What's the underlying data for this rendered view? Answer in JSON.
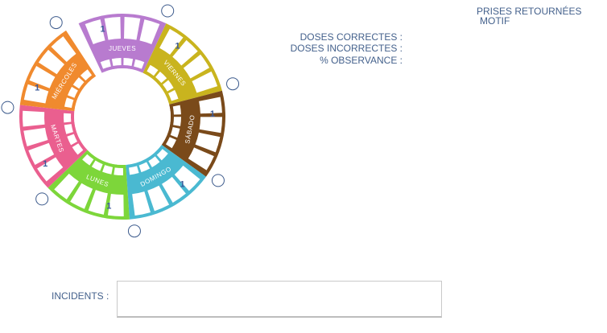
{
  "header": {
    "prises_retournees_label": "PRISES RETOURNÉES",
    "motif_label": "MOTIF"
  },
  "stats": {
    "doses_correctes_label": "DOSES CORRECTES :",
    "doses_incorrectes_label": "DOSES INCORRECTES :",
    "observance_label": "% OBSERVANCE :"
  },
  "incidents": {
    "label": "INCIDENTS :",
    "value": ""
  },
  "wheel": {
    "day_segments": [
      {
        "day": "JUEVES",
        "color": "#b87bcf",
        "count": "1"
      },
      {
        "day": "VIERNES",
        "color": "#c9b41e",
        "count": "1"
      },
      {
        "day": "SÁBADO",
        "color": "#7a4a1a",
        "count": "1"
      },
      {
        "day": "DOMINGO",
        "color": "#4ab9d1",
        "count": "1"
      },
      {
        "day": "LUNES",
        "color": "#7dd63a",
        "count": "1"
      },
      {
        "day": "MARTES",
        "color": "#ea5f8f",
        "count": "1"
      },
      {
        "day": "MIÉRCOLES",
        "color": "#f08a2e",
        "count": "1"
      }
    ],
    "gap_color": "#d8d8d8"
  }
}
